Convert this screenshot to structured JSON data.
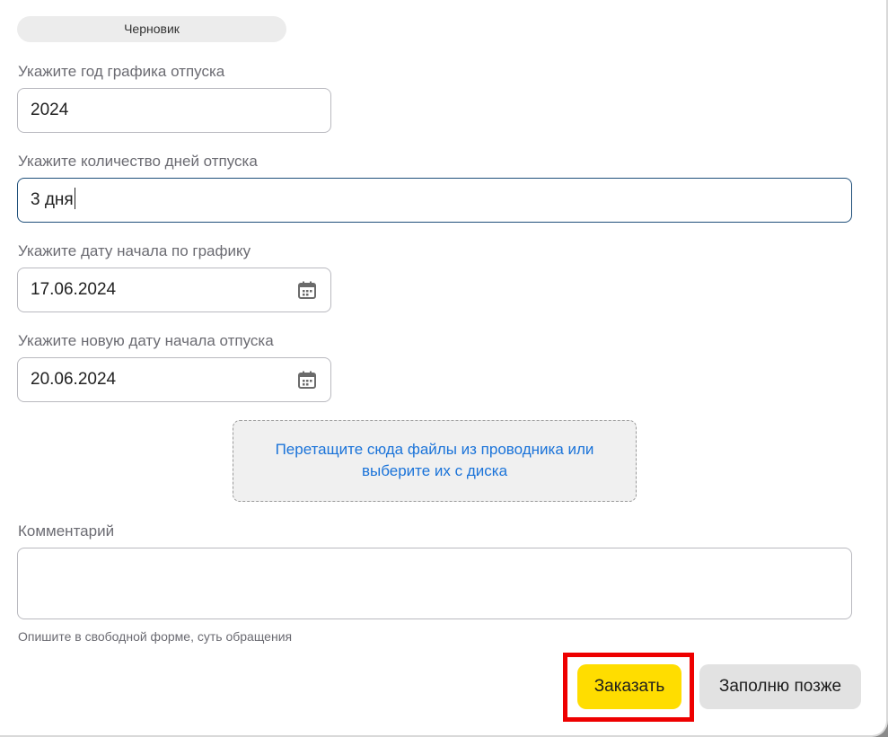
{
  "status": {
    "label": "Черновик"
  },
  "fields": {
    "year": {
      "label": "Укажите год графика отпуска",
      "value": "2024"
    },
    "days": {
      "label": "Укажите количество дней отпуска",
      "value": "3 дня"
    },
    "start_date": {
      "label": "Укажите дату начала по графику",
      "value": "17.06.2024",
      "icon": "calendar-icon"
    },
    "new_start_date": {
      "label": "Укажите новую дату начала отпуска",
      "value": "20.06.2024",
      "icon": "calendar-icon"
    }
  },
  "upload": {
    "line1": "Перетащите сюда файлы из проводника или",
    "line2": "выберите их с диска"
  },
  "comment": {
    "label": "Комментарий",
    "value": "",
    "hint": "Опишите в свободной форме, суть обращения"
  },
  "actions": {
    "submit_label": "Заказать",
    "later_label": "Заполню позже"
  },
  "colors": {
    "accent": "#ffdd00",
    "link": "#1a73d9",
    "highlight": "#ee0000",
    "focus_border": "#1f4f7a"
  }
}
